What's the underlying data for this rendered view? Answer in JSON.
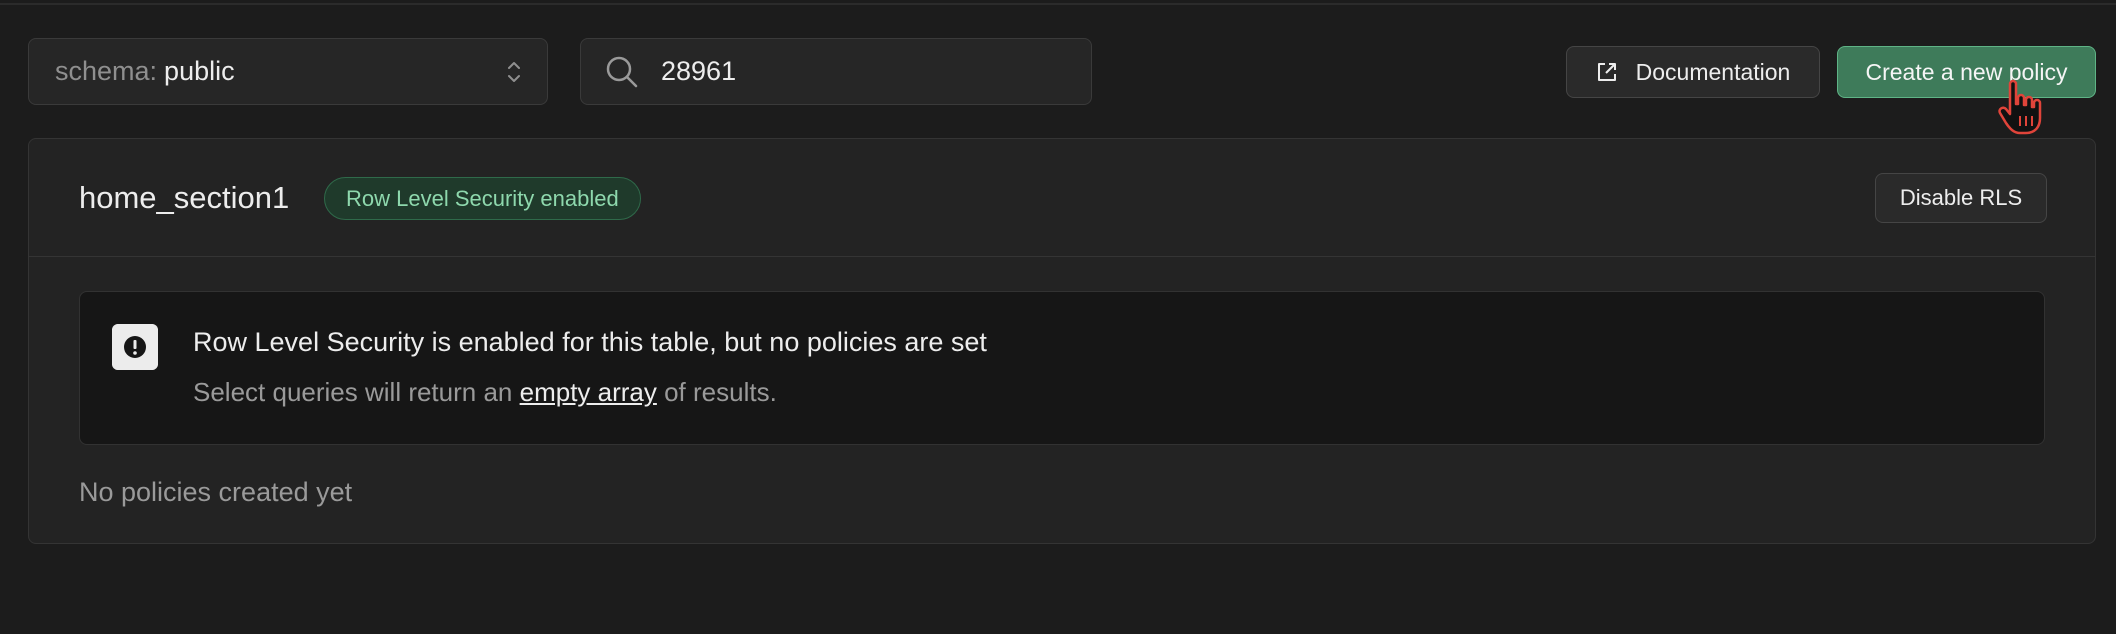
{
  "toolbar": {
    "schema_prefix": "schema:",
    "schema_value": "public",
    "search_value": "28961",
    "documentation_label": "Documentation",
    "create_policy_label": "Create a new policy"
  },
  "table": {
    "name": "home_section1",
    "rls_badge": "Row Level Security enabled",
    "disable_rls_label": "Disable RLS"
  },
  "alert": {
    "title": "Row Level Security is enabled for this table, but no policies are set",
    "desc_before": "Select queries will return an ",
    "desc_link": "empty array",
    "desc_after": " of results."
  },
  "empty_message": "No policies created yet",
  "colors": {
    "background": "#1c1c1c",
    "accent_green": "#3e7b5a",
    "badge_text": "#8ed8ad"
  },
  "icons": [
    "chevron-up-down-icon",
    "search-icon",
    "external-link-icon",
    "alert-icon",
    "hand-pointer-cursor"
  ]
}
